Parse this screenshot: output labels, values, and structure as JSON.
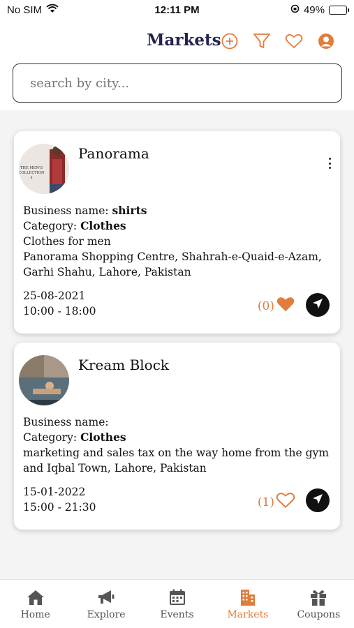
{
  "status_bar": {
    "carrier": "No SIM",
    "time": "12:11 PM",
    "battery": "49%",
    "battery_level": 0.49
  },
  "header": {
    "title": "Markets",
    "icons": [
      "add-circle-icon",
      "filter-icon",
      "heart-icon",
      "user-circle-icon"
    ],
    "accent_color": "#e07d3c",
    "title_color": "#22234f"
  },
  "search": {
    "placeholder": "search by city..."
  },
  "markets": [
    {
      "name": "Panorama",
      "avatar_text": "THE MEN'S COLLECTION",
      "business_label": "Business name: ",
      "business_value": "shirts",
      "category_label": "Category: ",
      "category_value": "Clothes",
      "description": "Clothes for men",
      "address": "Panorama Shopping Centre, Shahrah-e-Quaid-e-Azam, Garhi Shahu, Lahore, Pakistan",
      "date": "25-08-2021",
      "hours": "10:00 - 18:00",
      "likes": "(0)",
      "liked": true
    },
    {
      "name": "Kream Block",
      "business_label": "Business name:",
      "business_value": "",
      "category_label": "Category: ",
      "category_value": "Clothes",
      "description": "marketing and sales tax on the way home from the gym and Iqbal Town, Lahore, Pakistan",
      "date": "15-01-2022",
      "hours": "15:00 - 21:30",
      "likes": "(1)",
      "liked": false
    }
  ],
  "tabs": [
    {
      "label": "Home",
      "icon": "home-icon",
      "active": false
    },
    {
      "label": "Explore",
      "icon": "megaphone-icon",
      "active": false
    },
    {
      "label": "Events",
      "icon": "calendar-icon",
      "active": false
    },
    {
      "label": "Markets",
      "icon": "building-icon",
      "active": true
    },
    {
      "label": "Coupons",
      "icon": "gift-icon",
      "active": false
    }
  ]
}
